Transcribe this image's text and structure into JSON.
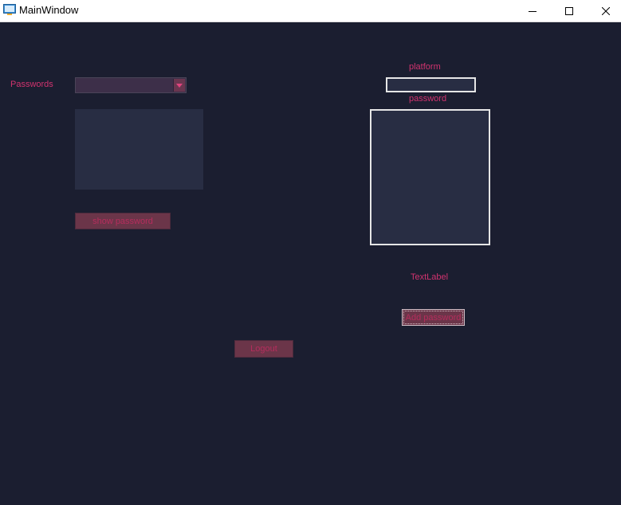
{
  "window": {
    "title": "MainWindow",
    "icon": "app-window-icon"
  },
  "left": {
    "passwords_label": "Passwords",
    "combo_value": "",
    "show_password_label": "show password"
  },
  "right": {
    "platform_label": "platform",
    "platform_value": "",
    "password_label": "password",
    "text_label": "TextLabel",
    "add_password_label": "Add password"
  },
  "footer": {
    "logout_label": "Logout"
  },
  "colors": {
    "background": "#1b1e30",
    "accent_text": "#d2336f",
    "button_bg": "#6b3549",
    "field_bg": "#282d43"
  }
}
